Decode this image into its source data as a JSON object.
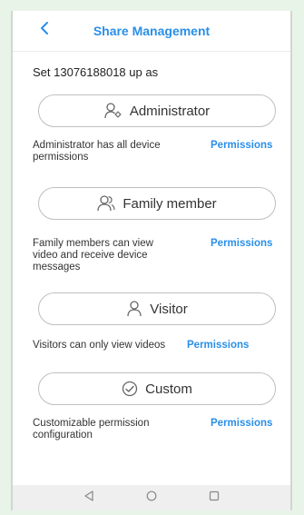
{
  "header": {
    "title": "Share Management",
    "back_icon": "chevron-left-icon"
  },
  "setup_text": "Set 13076188018 up as",
  "roles": [
    {
      "label": "Administrator",
      "icon": "admin-user-icon",
      "description": "Administrator has all device permissions",
      "permissions_label": "Permissions"
    },
    {
      "label": "Family member",
      "icon": "family-users-icon",
      "description": "Family members can view video and receive device messages",
      "permissions_label": "Permissions"
    },
    {
      "label": "Visitor",
      "icon": "user-icon",
      "description": "Visitors can only view videos",
      "permissions_label": "Permissions"
    },
    {
      "label": "Custom",
      "icon": "custom-check-icon",
      "description": "Customizable permission configuration",
      "permissions_label": "Permissions"
    }
  ],
  "navbar": {
    "back": "triangle-back-icon",
    "home": "circle-home-icon",
    "recents": "square-recents-icon"
  },
  "colors": {
    "accent": "#2a8fe8",
    "frame_bg": "#e9f4e9"
  }
}
